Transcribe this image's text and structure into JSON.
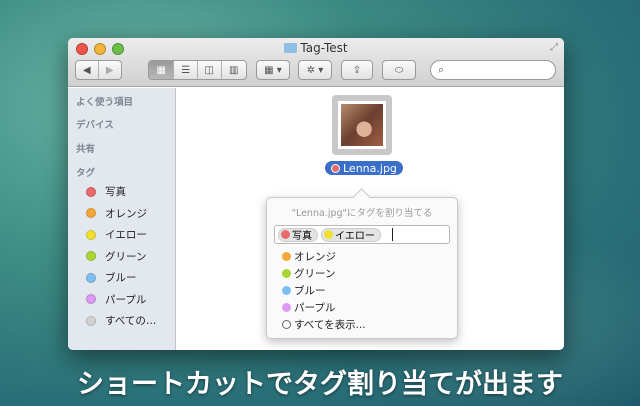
{
  "window": {
    "title": "Tag-Test"
  },
  "toolbar": {
    "back": "◀",
    "forward": "▶",
    "view_icons": "▦",
    "view_list": "☰",
    "view_columns": "◫",
    "view_coverflow": "▥",
    "arrange": "▦ ▾",
    "action": "✲ ▾",
    "share": "⇪",
    "tags": "⬭",
    "search_icon": "⌕"
  },
  "sidebar": {
    "favorites": "よく使う項目",
    "devices": "デバイス",
    "shared": "共有",
    "tags_header": "タグ",
    "tags": [
      {
        "label": "写真",
        "color": "#e86a6a"
      },
      {
        "label": "オレンジ",
        "color": "#f5a83a"
      },
      {
        "label": "イエロー",
        "color": "#f0e030"
      },
      {
        "label": "グリーン",
        "color": "#a8d632"
      },
      {
        "label": "ブルー",
        "color": "#7fbff0"
      },
      {
        "label": "パープル",
        "color": "#dc9af0"
      },
      {
        "label": "すべての…",
        "color": "#d2d2d2"
      }
    ]
  },
  "file": {
    "name": "Lenna.jpg",
    "tag_color": "#e86a6a"
  },
  "popover": {
    "heading": "\"Lenna.jpg\"にタグを割り当てる",
    "chips": [
      {
        "label": "写真",
        "color": "#e86a6a"
      },
      {
        "label": "イエロー",
        "color": "#f0e030"
      }
    ],
    "options": [
      {
        "label": "オレンジ",
        "color": "#f5a83a"
      },
      {
        "label": "グリーン",
        "color": "#a8d632"
      },
      {
        "label": "ブルー",
        "color": "#7fbff0"
      },
      {
        "label": "パープル",
        "color": "#dc9af0"
      }
    ],
    "show_all": "すべてを表示..."
  },
  "caption": "ショートカットでタグ割り当てが出ます"
}
